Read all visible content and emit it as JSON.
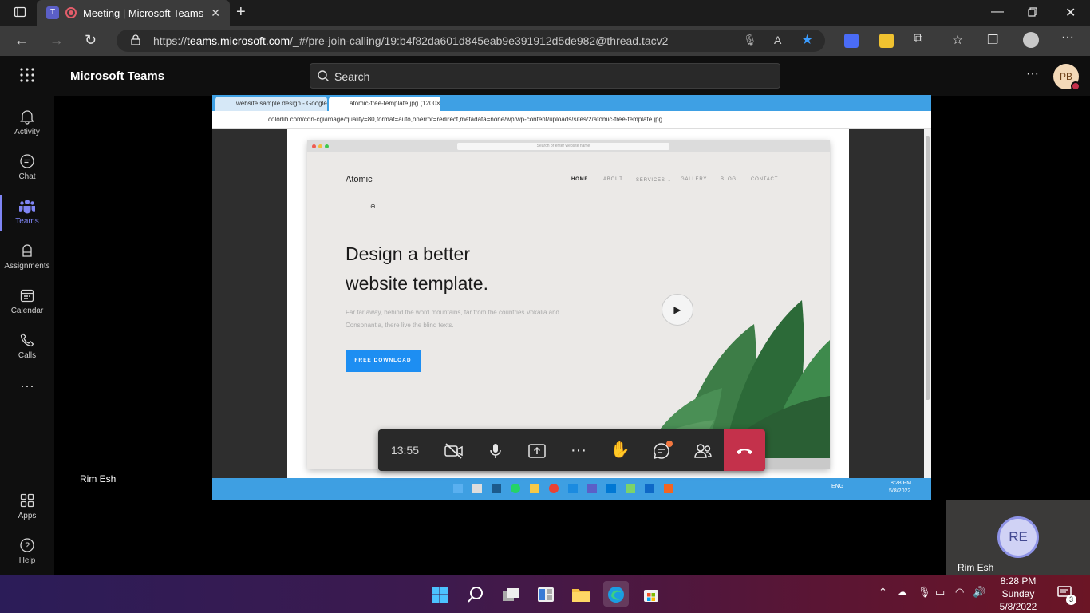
{
  "browser": {
    "tab_title": "Meeting | Microsoft Teams",
    "url_prefix": "https://",
    "url_host": "teams.microsoft.com",
    "url_path": "/_#/pre-join-calling/19:b4f82da601d845eab9e391912d5de982@thread.tacv2"
  },
  "teams": {
    "app_title": "Microsoft Teams",
    "search_placeholder": "Search",
    "user_initials": "PB",
    "more_label": "···"
  },
  "rail": {
    "items": [
      {
        "label": "Activity",
        "icon": "bell-icon"
      },
      {
        "label": "Chat",
        "icon": "chat-icon"
      },
      {
        "label": "Teams",
        "icon": "teams-icon",
        "active": true
      },
      {
        "label": "Assignments",
        "icon": "assignments-icon"
      },
      {
        "label": "Calendar",
        "icon": "calendar-icon"
      },
      {
        "label": "Calls",
        "icon": "phone-icon"
      }
    ],
    "more": "···",
    "apps_label": "Apps",
    "help_label": "Help",
    "active_color": "#7f85f5"
  },
  "shared_screen": {
    "tab1": "website sample design - Google",
    "tab2": "atomic-free-template.jpg (1200×",
    "url": "colorlib.com/cdn-cgi/image/quality=80,format=auto,onerror=redirect,metadata=none/wp/wp-content/uploads/sites/2/atomic-free-template.jpg",
    "mock_url": "Search or enter website name",
    "site": {
      "logo": "Atomic",
      "nav": [
        "HOME",
        "ABOUT",
        "SERVICES ⌄",
        "GALLERY",
        "BLOG",
        "CONTACT"
      ],
      "hero_line1": "Design a better",
      "hero_line2": "website template.",
      "hero_sub": "Far far away, behind the word mountains, far from the countries Vokalia and Consonantia, there live the blind texts.",
      "cta": "FREE DOWNLOAD"
    },
    "inner_tray": {
      "lang": "ENG",
      "time": "8:28 PM",
      "date": "5/8/2022"
    }
  },
  "meeting": {
    "timer": "13:55",
    "presenter_name": "Rim Esh",
    "self_name": "Rim Esh",
    "self_initials": "RE",
    "leave_color": "#c4314b"
  },
  "taskbar": {
    "time": "8:28 PM",
    "day": "Sunday",
    "date": "5/8/2022",
    "notification_count": "3"
  }
}
